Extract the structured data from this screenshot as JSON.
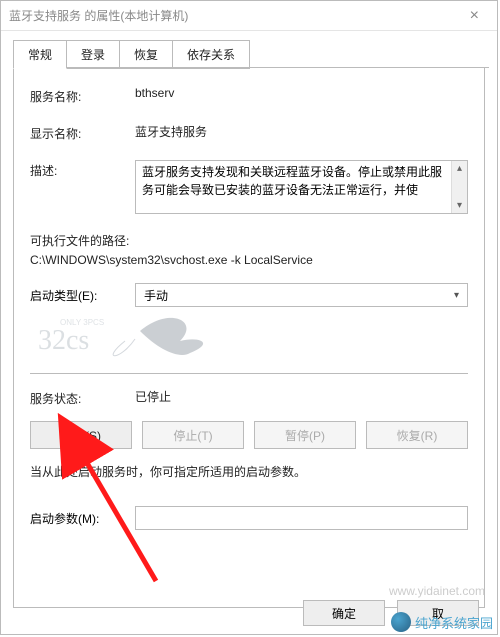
{
  "window": {
    "title": "蓝牙支持服务 的属性(本地计算机)"
  },
  "tabs": {
    "t0": "常规",
    "t1": "登录",
    "t2": "恢复",
    "t3": "依存关系"
  },
  "labels": {
    "service_name": "服务名称:",
    "display_name": "显示名称:",
    "description": "描述:",
    "exe_path": "可执行文件的路径:",
    "startup_type": "启动类型(E):",
    "service_status": "服务状态:",
    "hint": "当从此处启动服务时，你可指定所适用的启动参数。",
    "start_param": "启动参数(M):"
  },
  "values": {
    "service_name": "bthserv",
    "display_name": "蓝牙支持服务",
    "description": "蓝牙服务支持发现和关联远程蓝牙设备。停止或禁用此服务可能会导致已安装的蓝牙设备无法正常运行，并使",
    "exe_path": "C:\\WINDOWS\\system32\\svchost.exe -k LocalService",
    "startup_type": "手动",
    "service_status": "已停止",
    "start_param": ""
  },
  "buttons": {
    "start": "启动(S)",
    "stop": "停止(T)",
    "pause": "暂停(P)",
    "resume": "恢复(R)",
    "ok": "确定",
    "cancel_partial": "取"
  },
  "watermark": {
    "site": "www.yidainet.com",
    "corner": "纯净系统家园"
  }
}
